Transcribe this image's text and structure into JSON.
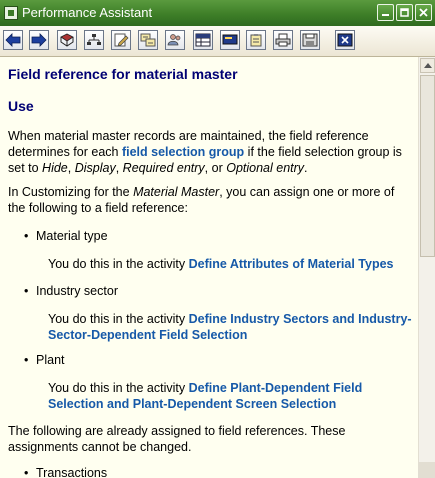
{
  "window": {
    "title": "Performance Assistant"
  },
  "titlebar": {
    "icons": [
      "app-icon",
      "minimize-icon",
      "maximize-icon",
      "close-icon"
    ]
  },
  "toolbar": {
    "buttons": [
      {
        "icon": "back-arrow-icon"
      },
      {
        "icon": "forward-arrow-icon"
      },
      {
        "icon": "book-icon"
      },
      {
        "icon": "structure-icon"
      },
      {
        "icon": "edit-icon"
      },
      {
        "icon": "technical-info-icon"
      },
      {
        "icon": "users-icon"
      },
      {
        "icon": "table-icon"
      },
      {
        "icon": "screen-icon"
      },
      {
        "icon": "clipboard-icon"
      },
      {
        "icon": "print-icon"
      },
      {
        "icon": "save-icon"
      },
      {
        "icon": "exit-icon"
      }
    ]
  },
  "content": {
    "title": "Field reference for material master",
    "section": "Use",
    "p1": {
      "t1": "When material master records are maintained, the field reference determines for each ",
      "link": "field selection group",
      "t2": " if the field selection group is set to ",
      "hide": "Hide",
      "c1": ", ",
      "display": "Display",
      "c2": ", ",
      "required": "Required entry",
      "c3": ", or ",
      "optional": "Optional entry",
      "end": "."
    },
    "p2": {
      "t1": "In Customizing for the ",
      "italic": "Material Master",
      "t2": ", you can assign one or more of the following to a field reference:"
    },
    "items": [
      {
        "label": "Material type",
        "pre": "You do this in the activity ",
        "link": "Define Attributes of Material Types"
      },
      {
        "label": "Industry sector",
        "pre": "You do this in the activity ",
        "link": "Define Industry Sectors and Industry-Sector-Dependent Field Selection"
      },
      {
        "label": "Plant",
        "pre": "You do this in the activity ",
        "link": "Define Plant-Dependent Field Selection and Plant-Dependent Screen Selection"
      }
    ],
    "p3": "The following are already assigned to field references. These assignments cannot be changed.",
    "item4": "Transactions"
  },
  "colors": {
    "titlebar": "#3e7f28",
    "heading": "#000073",
    "link": "#1659a8",
    "content_bg": "#fffff0"
  }
}
